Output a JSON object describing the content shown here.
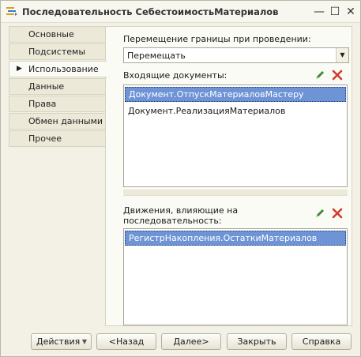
{
  "window": {
    "title": "Последовательность СебестоимостьМатериалов",
    "icon": "sequence-icon",
    "controls": {
      "minimize": "—",
      "maximize": "☐",
      "close": "✕"
    }
  },
  "tabs": [
    {
      "label": "Основные",
      "active": false
    },
    {
      "label": "Подсистемы",
      "active": false
    },
    {
      "label": "Использование",
      "active": true
    },
    {
      "label": "Данные",
      "active": false
    },
    {
      "label": "Права",
      "active": false
    },
    {
      "label": "Обмен данными",
      "active": false
    },
    {
      "label": "Прочее",
      "active": false
    }
  ],
  "panel": {
    "move_boundary_label": "Перемещение границы при проведении:",
    "move_boundary_value": "Перемещать",
    "documents_label": "Входящие  документы:",
    "documents": [
      {
        "label": "Документ.ОтпускМатериаловМастеру",
        "selected": true
      },
      {
        "label": "Документ.РеализацияМатериалов",
        "selected": false
      }
    ],
    "movements_label_line1": "Движения, влияющие на",
    "movements_label_line2": "последовательность:",
    "movements": [
      {
        "label": "РегистрНакопления.ОстаткиМатериалов",
        "selected": true
      }
    ],
    "icons": {
      "edit": "pencil-icon",
      "delete": "red-x-icon"
    }
  },
  "buttons": {
    "actions": "Действия",
    "back": "<Назад",
    "next": "Далее>",
    "close": "Закрыть",
    "help": "Справка"
  },
  "colors": {
    "selection": "#6f94d6",
    "window_bg": "#f3f1e6",
    "panel_bg": "#fbfbf6",
    "delete_icon": "#d43b2a",
    "edit_icon": "#3a8a2e"
  }
}
